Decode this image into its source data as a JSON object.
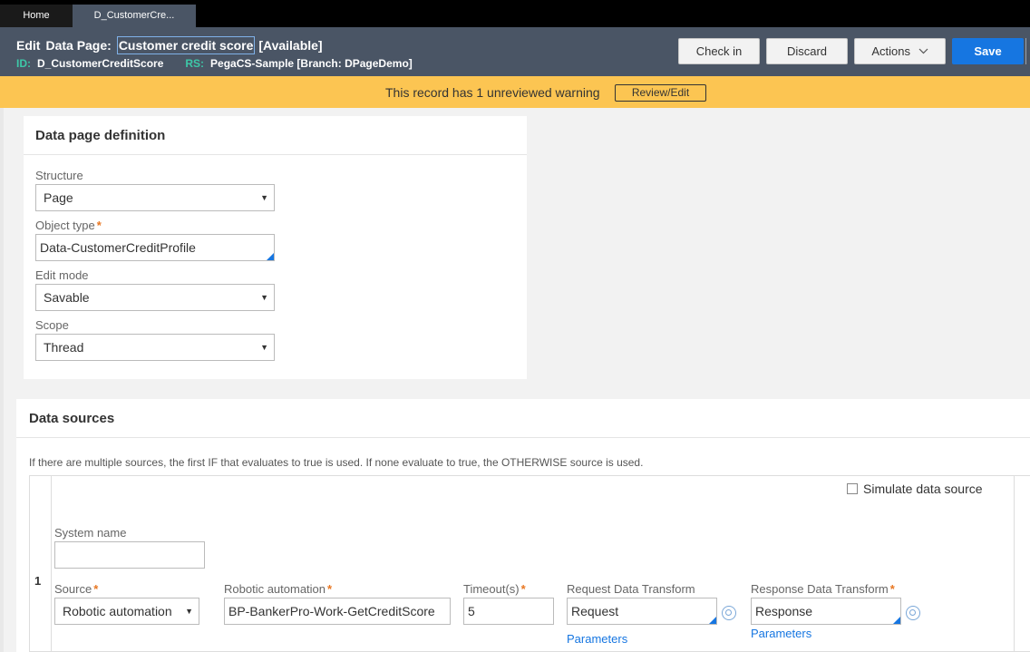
{
  "tabs": {
    "home": "Home",
    "active": "D_CustomerCre..."
  },
  "header": {
    "action_label": "Edit",
    "type_label": "Data Page:",
    "record_name": "Customer credit score",
    "status": "[Available]",
    "id_key": "ID:",
    "id_value": "D_CustomerCreditScore",
    "rs_key": "RS:",
    "rs_value": "PegaCS-Sample [Branch: DPageDemo]"
  },
  "toolbar": {
    "checkin": "Check in",
    "discard": "Discard",
    "actions": "Actions",
    "save": "Save"
  },
  "warning": {
    "text": "This record has 1 unreviewed warning",
    "button": "Review/Edit"
  },
  "definition": {
    "title": "Data page definition",
    "structure_label": "Structure",
    "structure_value": "Page",
    "object_type_label": "Object type",
    "object_type_value": "Data-CustomerCreditProfile",
    "edit_mode_label": "Edit mode",
    "edit_mode_value": "Savable",
    "scope_label": "Scope",
    "scope_value": "Thread",
    "required_mark": "*"
  },
  "sources": {
    "title": "Data sources",
    "hint": "If there are multiple sources, the first IF that evaluates to true is used. If none evaluate to true, the OTHERWISE source is used.",
    "row_number": "1",
    "simulate_label": "Simulate data source",
    "system_name_label": "System name",
    "system_name_value": "",
    "source_label": "Source",
    "source_value": "Robotic automation",
    "robotic_label": "Robotic automation",
    "robotic_value": "BP-BankerPro-Work-GetCreditScore",
    "timeout_label": "Timeout(s)",
    "timeout_value": "5",
    "request_label": "Request Data Transform",
    "request_value": "Request",
    "request_params": "Parameters",
    "response_label": "Response Data Transform",
    "response_value": "Response",
    "response_params": "Parameters"
  },
  "icons": {
    "caret": "dropdown-caret-icon",
    "chevron": "chevron-down-icon",
    "target": "crosshair-target-icon"
  },
  "colors": {
    "header_bg": "#4a5565",
    "warning_bg": "#fcc552",
    "accent": "#1676e1",
    "required": "#e87722",
    "id_key": "#3dc8a8"
  }
}
